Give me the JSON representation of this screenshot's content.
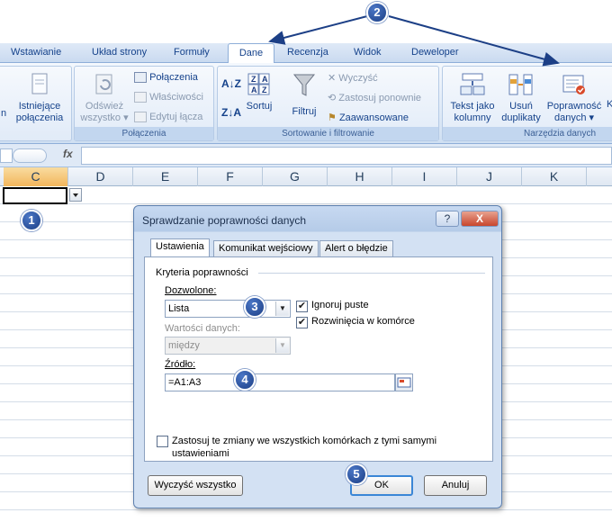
{
  "ribbon": {
    "tabs": [
      "Wstawianie",
      "Układ strony",
      "Formuły",
      "Dane",
      "Recenzja",
      "Widok",
      "Deweloper"
    ],
    "active_tab": "Dane",
    "groups": {
      "connections_title": "Połączenia",
      "sort_title": "Sortowanie i filtrowanie",
      "tools_title": "Narzędzia danych"
    },
    "buttons": {
      "existing_connections_1": "Istniejące",
      "existing_connections_2": "połączenia",
      "refresh_1": "Odśwież",
      "refresh_2": "wszystko ▾",
      "connections": "Połączenia",
      "properties": "Właściwości",
      "edit_links": "Edytuj łącza",
      "sort": "Sortuj",
      "filter": "Filtruj",
      "clear": "Wyczyść",
      "reapply": "Zastosuj ponownie",
      "advanced": "Zaawansowane",
      "text_to_columns_1": "Tekst jako",
      "text_to_columns_2": "kolumny",
      "remove_dup_1": "Usuń",
      "remove_dup_2": "duplikaty",
      "validation_1": "Poprawność",
      "validation_2": "danych ▾",
      "cut_left": "n",
      "cut_right": "K"
    }
  },
  "formula_bar": {
    "fx": "fx",
    "value": ""
  },
  "grid": {
    "columns": [
      "C",
      "D",
      "E",
      "F",
      "G",
      "H",
      "I",
      "J",
      "K"
    ],
    "selected_column": "C"
  },
  "badges": [
    "1",
    "2",
    "3",
    "4",
    "5"
  ],
  "dialog": {
    "title": "Sprawdzanie poprawności danych",
    "help": "?",
    "close": "X",
    "tabs": [
      "Ustawienia",
      "Komunikat wejściowy",
      "Alert o błędzie"
    ],
    "section": "Kryteria poprawności",
    "allow_label": "Dozwolone:",
    "allow_value": "Lista",
    "ignore_blank": "Ignoruj puste",
    "in_cell_dropdown": "Rozwinięcia w komórce",
    "data_label": "Wartości danych:",
    "data_value": "między",
    "source_label": "Źródło:",
    "source_value": "=A1:A3",
    "apply_all": "Zastosuj te zmiany we wszystkich komórkach z tymi samymi",
    "apply_all_2": "ustawieniami",
    "clear_all": "Wyczyść wszystko",
    "ok": "OK",
    "cancel": "Anuluj"
  },
  "colors": {
    "accent": "#1c3f86",
    "ribbon": "#dbe7f6",
    "selected_col": "#f2b65c"
  }
}
